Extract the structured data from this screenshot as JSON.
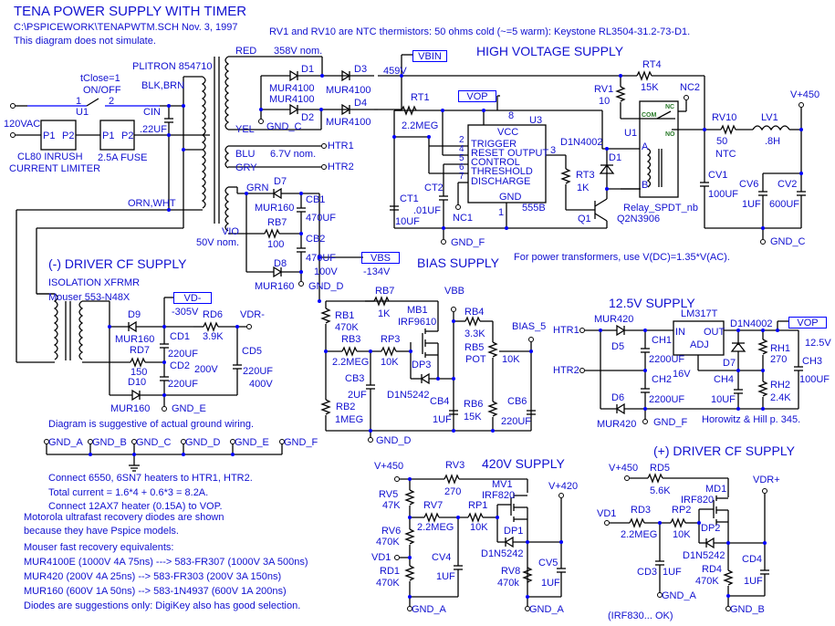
{
  "header": {
    "title": "TENA POWER SUPPLY WITH TIMER",
    "file": "C:\\PSPICEWORK\\TENAPWTM.SCH  Nov. 3, 1997",
    "note": "This diagram does not simulate.",
    "thermistor_note": "RV1 and RV10 are NTC thermistors: 50 ohms cold (~=5 warm): Keystone RL3504-31.2-73-D1."
  },
  "sections": {
    "hv": "HIGH VOLTAGE SUPPLY",
    "bias": "BIAS SUPPLY",
    "neg_driver": "(-) DRIVER CF SUPPLY",
    "v125": "12.5V SUPPLY",
    "v420": "420V SUPPLY",
    "pos_driver": "(+) DRIVER CF SUPPLY"
  },
  "input": {
    "switch_param": "tClose=1",
    "switch_label": "ON/OFF",
    "switch_ref": "U1",
    "pin1": "1",
    "pin2": "2",
    "ac": "120VAC",
    "limiter_p1": "P1",
    "limiter_p2": "P2",
    "limiter_label1": "CL80 INRUSH",
    "limiter_label2": "CURRENT LIMITER",
    "fuse_p1": "P1",
    "fuse_p2": "P2",
    "fuse_label": "2.5A FUSE",
    "cin": "CIN",
    "cin_val": ".22UF"
  },
  "transformer": {
    "name": "PLITRON 854710",
    "pri1": "BLK,BRN",
    "pri2": "ORN,WHT",
    "red": "RED",
    "hv_nom": "358V nom.",
    "yel": "YEL",
    "blu": "BLU",
    "htr_nom": "6.7V nom.",
    "gry": "GRY",
    "grn": "GRN",
    "vio": "VIO",
    "bias_nom": "50V nom.",
    "htr1": "HTR1",
    "htr2": "HTR2"
  },
  "hv_rect": {
    "d1": "D1",
    "d2": "D2",
    "d3": "D3",
    "d4": "D4",
    "d1v": "MUR4100",
    "d2v": "MUR4100",
    "d3v": "MUR4100",
    "d4v": "MUR4100",
    "gnd": "GND_C",
    "vbin": "VBIN",
    "vbin_v": "459V"
  },
  "timer": {
    "rt1": "RT1",
    "rt1v": "2.2MEG",
    "vop": "VOP",
    "u3": "U3",
    "vcc": "VCC",
    "gnd": "GND",
    "model": "555B",
    "pins": [
      "TRIGGER",
      "RESET",
      "CONTROL",
      "THRESHOLD",
      "DISCHARGE"
    ],
    "pin_nums": [
      "2",
      "4",
      "5",
      "6",
      "7"
    ],
    "output": "OUTPUT",
    "p8": "8",
    "p3": "3",
    "p1": "1",
    "ct1": "CT1",
    "ct1v": "10UF",
    "ct2": "CT2",
    "ct2v": ".01UF",
    "nc1": "NC1",
    "gndf": "GND_F",
    "rt3": "RT3",
    "rt3v": "1K",
    "q1": "Q1",
    "q1m": "Q2N3906",
    "d1n": "D1N4002",
    "d1": "D1"
  },
  "relay": {
    "rv1": "RV1",
    "rv1v": "10",
    "rt4": "RT4",
    "rt4v": "15K",
    "nc2": "NC2",
    "u1": "U1",
    "model": "Relay_SPDT_nb",
    "com": "COM",
    "nc": "NC",
    "no": "NO",
    "a": "A",
    "b": "B"
  },
  "hv_out": {
    "rv10": "RV10",
    "rv10v": "50",
    "rv10t": "NTC",
    "lv1": "LV1",
    "lv1v": ".8H",
    "vout": "V+450",
    "cv1": "CV1",
    "cv1v": "100UF",
    "cv6": "CV6",
    "cv6v": "1UF",
    "cv2": "CV2",
    "cv2v": "600UF",
    "gnd": "GND_C",
    "xfmr_note": "For power transformers, use V(DC)=1.35*V(AC)."
  },
  "bias_rect": {
    "d7": "D7",
    "d7v": "MUR160",
    "d8": "D8",
    "d8v": "MUR160",
    "cb1": "CB1",
    "cb1v": "470UF",
    "cb2": "CB2",
    "cb2v": "470UF",
    "cbv": "100V",
    "rb7": "RB7",
    "rb7v": "100",
    "gnd": "GND_D",
    "vbs": "VBS",
    "vbs_v": "-134V"
  },
  "bias": {
    "rb1": "RB1",
    "rb1v": "470K",
    "rb7": "RB7",
    "rb7v": "1K",
    "mb1": "MB1",
    "mb1m": "IRF9610",
    "vbb": "VBB",
    "rb3": "RB3",
    "rb3v": "2.2MEG",
    "rp3": "RP3",
    "rp3v": "10K",
    "dp3": "DP3",
    "dp3m": "D1N5242",
    "cb3": "CB3",
    "cb3v": "2UF",
    "rb2": "RB2",
    "rb2v": "1MEG",
    "cb4": "CB4",
    "cb4v": "1UF",
    "rb4": "RB4",
    "rb4v": "3.3K",
    "rb5": "RB5",
    "rb5t": "POT",
    "rb5v": "10K",
    "rb6": "RB6",
    "rb6v": "15K",
    "cb6": "CB6",
    "cb6v": "220UF",
    "out": "BIAS_5",
    "gnd": "GND_D"
  },
  "neg_driver": {
    "xfmr": "ISOLATION XFRMR",
    "part": "Mouser 553-N48X",
    "vd": "VD-",
    "vd_v": "-305V",
    "d9": "D9",
    "d9v": "MUR160",
    "d10": "D10",
    "d10v": "MUR160",
    "rd7": "RD7",
    "rd7v": "150",
    "rd6": "RD6",
    "rd6v": "3.9K",
    "cd1": "CD1",
    "cd1v": "220UF",
    "cd2": "CD2",
    "cd2v": "220UF",
    "cdv": "200V",
    "cd5": "CD5",
    "cd5v": "220UF",
    "cd5r": "400V",
    "out": "VDR-",
    "gnd": "GND_E",
    "note": "Diagram is suggestive of actual ground wiring."
  },
  "grounds": [
    "GND_A",
    "GND_B",
    "GND_C",
    "GND_D",
    "GND_E",
    "GND_F"
  ],
  "v125": {
    "htr1": "HTR1",
    "htr2": "HTR2",
    "d5": "D5",
    "d5v": "MUR420",
    "d6": "D6",
    "d6v": "MUR420",
    "ch1": "CH1",
    "ch1v": "2200UF",
    "ch2": "CH2",
    "ch2v": "2200UF",
    "chv": "16V",
    "reg": "LM317T",
    "in": "IN",
    "out": "OUT",
    "adj": "ADJ",
    "d7": "D7",
    "d7m": "D1N4002",
    "ch4": "CH4",
    "ch4v": "10UF",
    "rh1": "RH1",
    "rh1v": "270",
    "rh2": "RH2",
    "rh2v": "2.4K",
    "ch3": "CH3",
    "ch3v": "100UF",
    "vop": "VOP",
    "vout": "12.5V",
    "gnd": "GND_F",
    "ref": "Horowitz & Hill p. 345."
  },
  "notes": [
    "Connect 6550, 6SN7 heaters to HTR1, HTR2.",
    "Total current = 1.6*4 + 0.6*3 = 8.2A.",
    "Connect 12AX7 heater (0.15A) to VOP.",
    "Motorola ultrafast recovery diodes are shown",
    "because they have Pspice models.",
    "Mouser fast recovery equivalents:",
    "MUR4100E (1000V 4A 75ns) ---> 583-FR307 (1000V 3A 500ns)",
    "MUR420 (200V 4A 25ns) --> 583-FR303 (200V 3A 150ns)",
    "MUR160 (600V 1A 50ns) --> 583-1N4937 (600V 1A 200ns)",
    "Diodes are suggestions only:  DigiKey also has good selection."
  ],
  "v420": {
    "vin": "V+450",
    "rv3": "RV3",
    "rv3v": "270",
    "rv5": "RV5",
    "rv5v": "47K",
    "rv6": "RV6",
    "rv6v": "470K",
    "vd1": "VD1",
    "rd1": "RD1",
    "rd1v": "470K",
    "rv7": "RV7",
    "rv7v": "2.2MEG",
    "rp1": "RP1",
    "rp1v": "10K",
    "mv1": "MV1",
    "mv1m": "IRF820",
    "dp1": "DP1",
    "dp1m": "D1N5242",
    "cv4": "CV4",
    "cv4v": "1UF",
    "rv8": "RV8",
    "rv8v": "470k",
    "cv5": "CV5",
    "cv5v": "1UF",
    "vout": "V+420",
    "gnd": "GND_A"
  },
  "pos_driver": {
    "vin": "V+450",
    "rd5": "RD5",
    "rd5v": "5.6K",
    "md1": "MD1",
    "md1m": "IRF820",
    "vd1": "VD1",
    "rd3": "RD3",
    "rd3v": "2.2MEG",
    "rp2": "RP2",
    "rp2v": "10K",
    "dp2": "DP2",
    "dp2m": "D1N5242",
    "cd3": "CD3",
    "cd3v": "1UF",
    "rd4": "RD4",
    "rd4v": "470K",
    "cd4": "CD4",
    "cd4v": "1UF",
    "vout": "VDR+",
    "gnda": "GND_A",
    "gndb": "GND_B",
    "note": "(IRF830... OK)"
  }
}
